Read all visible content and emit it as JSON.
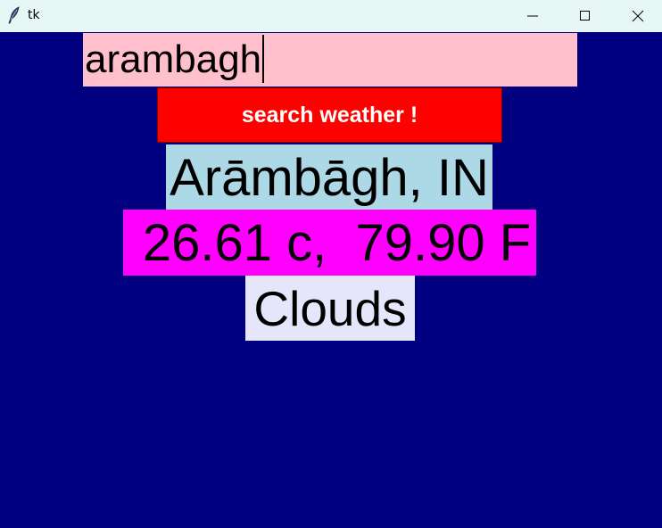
{
  "window": {
    "title": "tk",
    "app_icon": "tk-feather-icon",
    "controls": {
      "minimize_icon": "minimize-icon",
      "maximize_icon": "maximize-icon",
      "close_icon": "close-icon"
    }
  },
  "search": {
    "value": "arambagh"
  },
  "search_button": {
    "label": "search weather !"
  },
  "result": {
    "location": "Arāmbāgh, IN",
    "temperature": " 26.61 c,  79.90 F",
    "condition": "Clouds"
  },
  "colors": {
    "background": "#000080",
    "entry_bg": "#ffc0cb",
    "button_bg": "#ff0000",
    "location_bg": "#add8e6",
    "temperature_bg": "#ff00ff",
    "condition_bg": "#e6e6fa"
  }
}
